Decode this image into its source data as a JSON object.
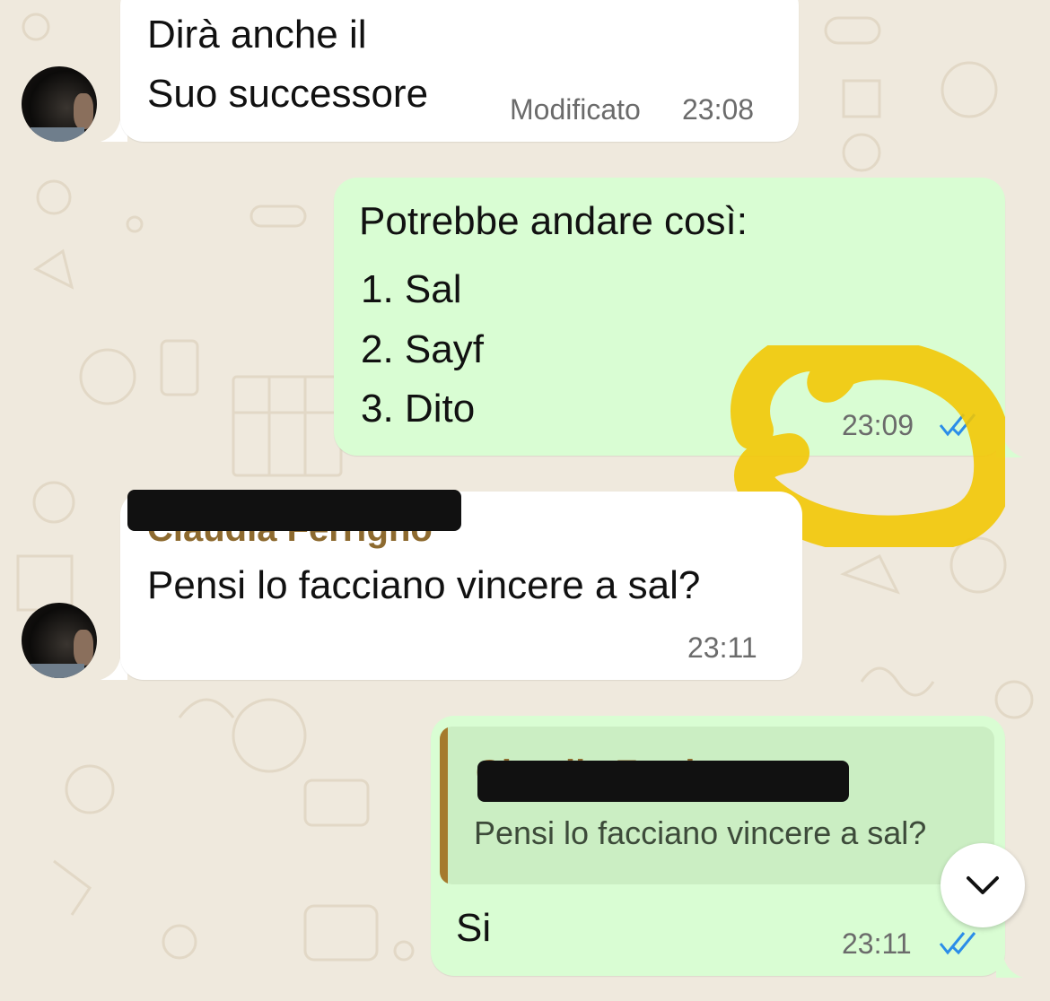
{
  "messages": [
    {
      "id": "m1",
      "direction": "incoming",
      "lines": [
        "Dirà anche il",
        "Suo successore"
      ],
      "edited_label": "Modificato",
      "time": "23:08"
    },
    {
      "id": "m2",
      "direction": "outgoing",
      "heading": "Potrebbe andare così:",
      "list": [
        "1. Sal",
        "2. Sayf",
        "3. Dito"
      ],
      "time": "23:09",
      "status": "read"
    },
    {
      "id": "m3",
      "direction": "incoming",
      "sender": "Claudia Ferrigno",
      "text": "Pensi lo facciano vincere a sal?",
      "time": "23:11"
    },
    {
      "id": "m4",
      "direction": "outgoing",
      "reply": {
        "sender": "Claudia Ferrigno",
        "text": "Pensi lo facciano vincere a sal?"
      },
      "text": "Si",
      "time": "23:11",
      "status": "read"
    }
  ],
  "icons": {
    "read_receipt": "double-check-icon",
    "scroll_down": "chevron-down-icon"
  },
  "colors": {
    "incoming_bubble": "#ffffff",
    "outgoing_bubble": "#d9fdd3",
    "read_tick": "#2b8de8",
    "sender_name": "#8d6a2f",
    "highlight": "#f5c400",
    "wallpaper": "#efe9dd"
  }
}
